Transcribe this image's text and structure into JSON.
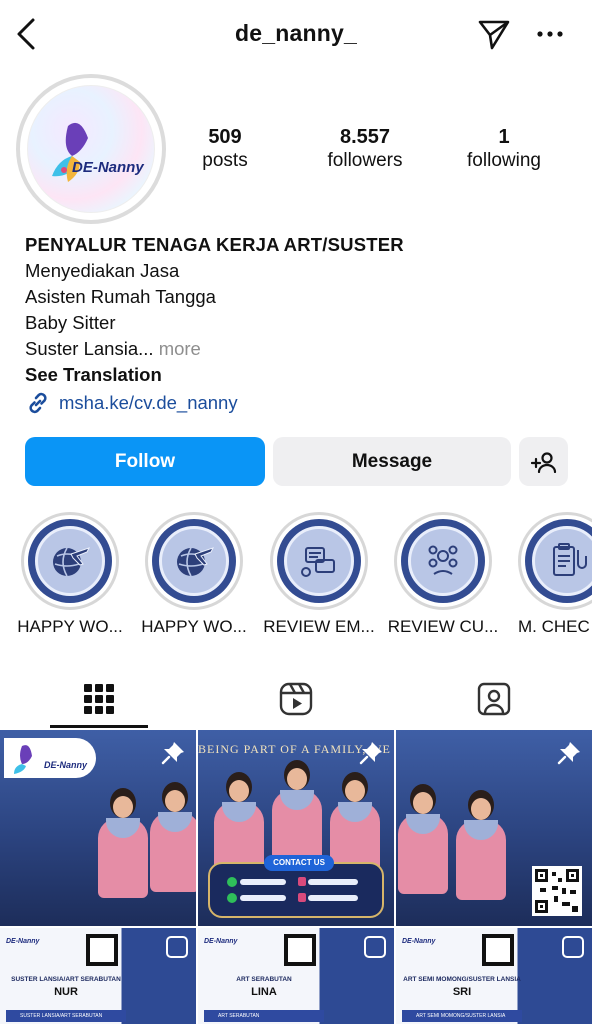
{
  "header": {
    "username": "de_nanny_"
  },
  "profile": {
    "avatar_logo_text": "DE-Nanny",
    "stats": [
      {
        "value": "509",
        "label": "posts"
      },
      {
        "value": "8.557",
        "label": "followers"
      },
      {
        "value": "1",
        "label": "following"
      }
    ],
    "bio": {
      "name": "PENYALUR TENAGA KERJA ART/SUSTER",
      "lines": [
        "Menyediakan Jasa",
        "Asisten Rumah Tangga",
        "Baby Sitter",
        "Suster Lansia..."
      ],
      "more": "more",
      "see_translation": "See Translation",
      "link": "msha.ke/cv.de_nanny"
    }
  },
  "actions": {
    "follow": "Follow",
    "message": "Message"
  },
  "highlights": [
    {
      "label": "HAPPY WO...",
      "icon": "globe-plane-icon"
    },
    {
      "label": "HAPPY WO...",
      "icon": "globe-plane-icon"
    },
    {
      "label": "REVIEW EM...",
      "icon": "review-chat-icon"
    },
    {
      "label": "REVIEW CU...",
      "icon": "customer-icon"
    },
    {
      "label": "M. CHEC",
      "icon": "medical-clipboard-icon"
    }
  ],
  "tabs": [
    "grid-icon",
    "reels-icon",
    "tagged-icon"
  ],
  "posts": {
    "top": [
      {
        "logo": "DE-Nanny",
        "banner": ""
      },
      {
        "banner": "BEING PART OF A FAMILY, WE MAKE A HOUSE BECOMES HOME",
        "contact_title": "CONTACT US"
      },
      {
        "banner": ""
      }
    ],
    "bottom": [
      {
        "logo": "DE-Nanny",
        "title": "SUSTER LANSIA/ART SERABUTAN",
        "name": "NUR",
        "sub": "SUSTER LANSIA/ART SERABUTAN"
      },
      {
        "logo": "DE-Nanny",
        "title": "ART SERABUTAN",
        "name": "LINA",
        "sub": "ART SERABUTAN"
      },
      {
        "logo": "DE-Nanny",
        "title": "ART SEMI MOMONG/SUSTER LANSIA",
        "name": "SRI",
        "sub": "ART SEMI MOMONG/SUSTER LANSIA"
      }
    ]
  },
  "colors": {
    "follow_blue": "#0a95f6",
    "link_blue": "#1b4d9c",
    "highlight_navy": "#334c92"
  }
}
